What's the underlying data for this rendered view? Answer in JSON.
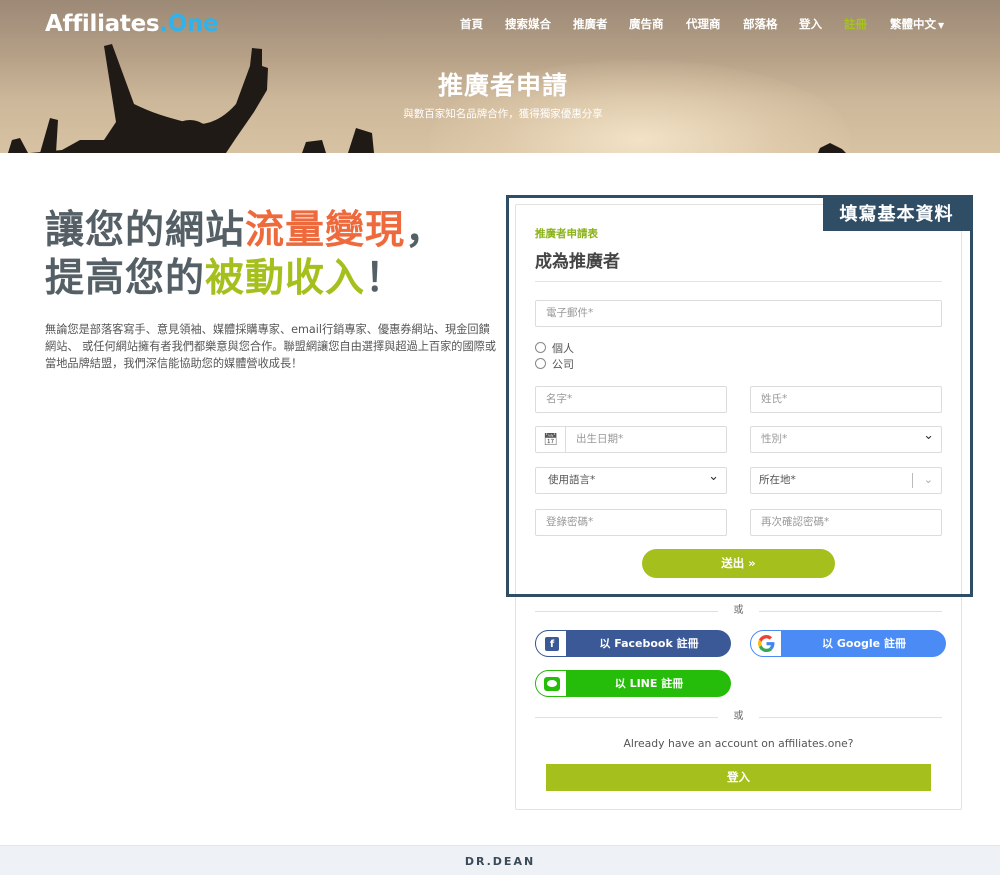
{
  "header": {
    "logo_prefix": "Affiliates",
    "logo_suffix": ".One",
    "nav": [
      {
        "label": "首頁"
      },
      {
        "label": "搜索媒合"
      },
      {
        "label": "推廣者"
      },
      {
        "label": "廣告商"
      },
      {
        "label": "代理商"
      },
      {
        "label": "部落格"
      },
      {
        "label": "登入"
      },
      {
        "label": "註冊"
      },
      {
        "label": "繁體中文"
      }
    ],
    "active_nav": "註冊",
    "nav_caret_icon": "caret-down-icon"
  },
  "hero": {
    "title": "推廣者申請",
    "subtitle": "與數百家知名品牌合作，獲得獨家優惠分享"
  },
  "intro": {
    "headline_line1_a": "讓您的網站",
    "headline_line1_b": "流量變現",
    "headline_line1_c": "，",
    "headline_line2_a": "提高您的",
    "headline_line2_b": "被動收入",
    "headline_line2_c": "！",
    "body": "無論您是部落客寫手、意見領袖、媒體採購專家、email行銷專家、優惠券網站、現金回饋網站、 或任何網站擁有者我們都樂意與您合作。聯盟網讓您自由選擇與超過上百家的國際或當地品牌結盟，我們深信能協助您的媒體營收成長！"
  },
  "annotation": {
    "tag": "填寫基本資料"
  },
  "form": {
    "eyebrow": "推廣者申請表",
    "title": "成為推廣者",
    "email_placeholder": "電子郵件*",
    "account_types": [
      "個人",
      "公司"
    ],
    "first_name_placeholder": "名字*",
    "last_name_placeholder": "姓氏*",
    "birthday_placeholder": "出生日期*",
    "gender_placeholder": "性別*",
    "language_placeholder": "使用語言*",
    "location_placeholder": "所在地*",
    "password_placeholder": "登錄密碼*",
    "confirm_password_placeholder": "再次確認密碼*",
    "submit_label": "送出",
    "submit_icon": "double-chevron-right-icon"
  },
  "social": {
    "or_1": "或",
    "facebook_label": "以 Facebook 註冊",
    "google_label": "以 Google 註冊",
    "line_label": "以 LINE 註冊",
    "or_2": "或",
    "have_account": "Already have an account on affiliates.one?",
    "login_label": "登入"
  },
  "footer": {
    "brand": "DR.DEAN"
  },
  "colors": {
    "accent_green": "#a5c01c",
    "accent_orange": "#ee6a3d",
    "highlight_navy": "#2f4d64",
    "facebook_blue": "#3b5897",
    "google_blue": "#4a8bf5",
    "line_green": "#25bd09"
  }
}
